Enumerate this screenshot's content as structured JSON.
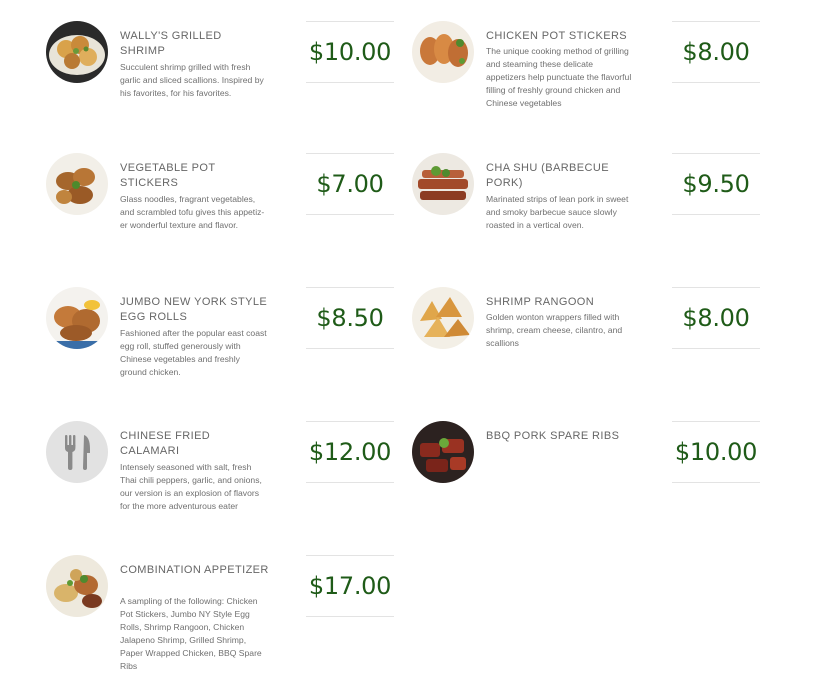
{
  "colors": {
    "price": "#1f5b18",
    "name": "#666666",
    "desc": "#707070",
    "divider": "#e3e3e3"
  },
  "menu": {
    "left": [
      {
        "name": "WALLY'S GRILLED SHRIMP",
        "description": "Succulent shrimp grilled with fresh garlic and sliced scallions. Inspired by his favorites, for his favorites.",
        "price": "$10.00",
        "image": "shrimp-photo"
      },
      {
        "name": "VEGETABLE POT STICKERS",
        "description": "Glass noodles, fragrant vegetables, and scrambled tofu gives this appetiz-er wonderful texture and flavor.",
        "price": "$7.00",
        "image": "potstickers-photo"
      },
      {
        "name": "JUMBO NEW YORK STYLE EGG ROLLS",
        "description": "Fashioned after the popular east coast egg roll, stuffed generously with Chinese vegetables and freshly ground chicken.",
        "price": "$8.50",
        "image": "eggroll-photo"
      },
      {
        "name": "CHINESE FRIED CALAMARI",
        "description": "Intensely seasoned with salt, fresh Thai chili peppers, garlic, and onions, our version is an explosion of flavors for the more adventurous eater",
        "price": "$12.00",
        "image": "utensils-icon"
      },
      {
        "name": "COMBINATION APPETIZER",
        "description": "A sampling of the following: Chicken Pot Stickers, Jumbo NY Style Egg Rolls, Shrimp Rangoon, Chicken Jalapeno Shrimp, Grilled Shrimp, Paper Wrapped Chicken, BBQ Spare Ribs",
        "price": "$17.00",
        "image": "combo-photo"
      }
    ],
    "right": [
      {
        "name": "CHICKEN POT STICKERS",
        "description": "The unique cooking method of grilling and steaming these delicate appetizers help punctuate the flavorful filling of freshly ground chicken and Chinese vegetables",
        "price": "$8.00",
        "image": "chicken-potstickers-photo"
      },
      {
        "name": "CHA SHU (BARBECUE PORK)",
        "description": "Marinated strips of lean pork in sweet and smoky barbecue sauce slowly roasted in a vertical oven.",
        "price": "$9.50",
        "image": "chashu-photo"
      },
      {
        "name": "SHRIMP RANGOON",
        "description": "Golden wonton wrappers filled with shrimp, cream cheese, cilantro, and scallions",
        "price": "$8.00",
        "image": "rangoon-photo"
      },
      {
        "name": "BBQ PORK SPARE RIBS",
        "description": "",
        "price": "$10.00",
        "image": "spareribs-photo"
      }
    ]
  }
}
